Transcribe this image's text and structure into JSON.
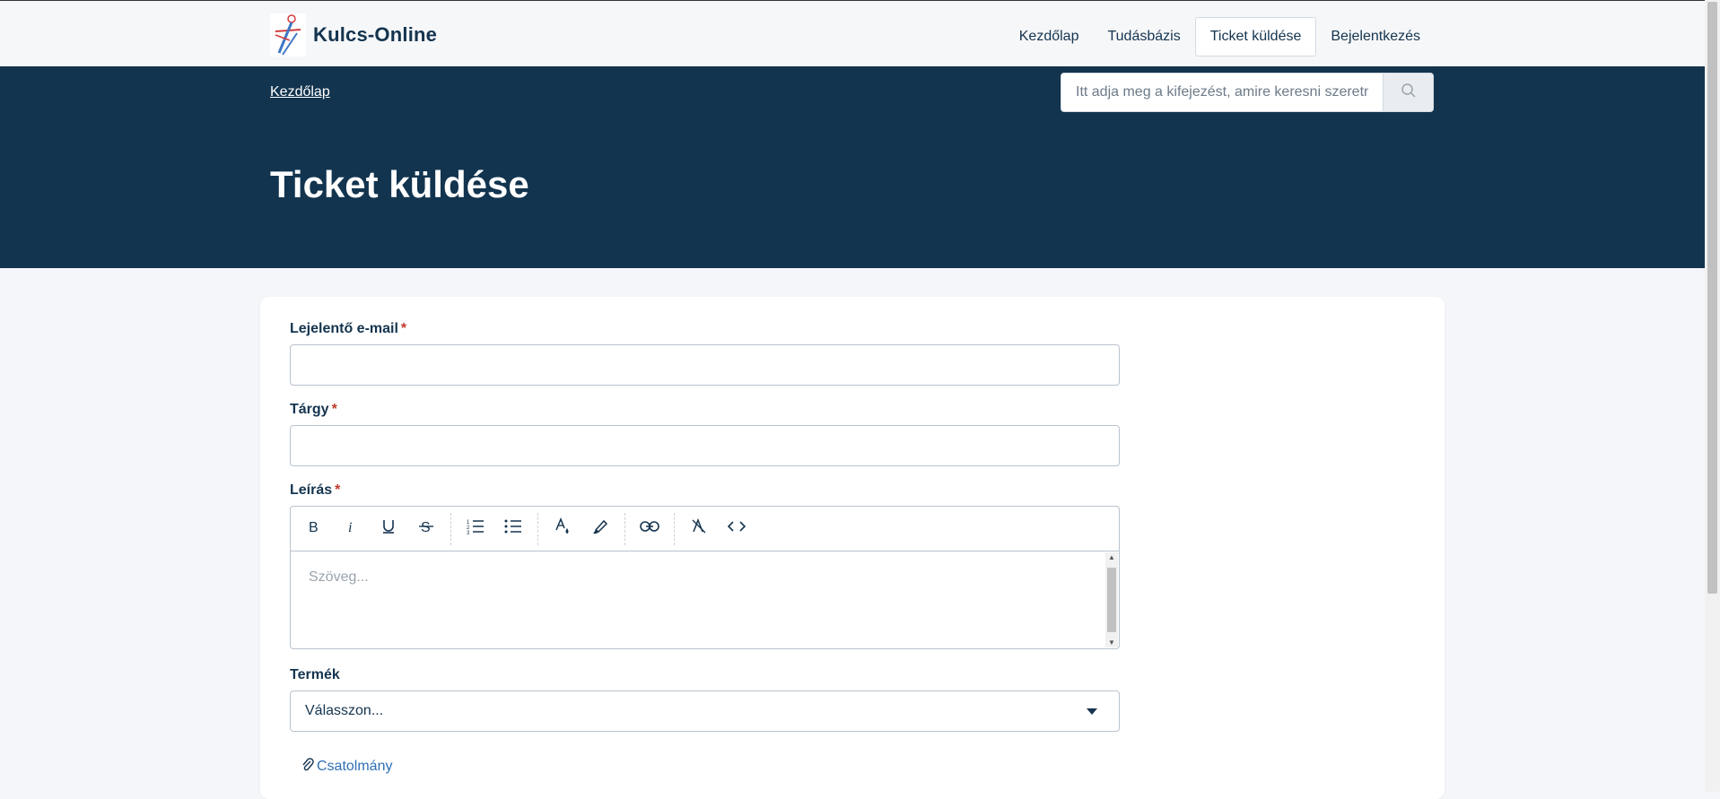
{
  "brand": {
    "name": "Kulcs-Online",
    "logo_icon": "kulcs-logo-icon"
  },
  "nav": {
    "items": [
      {
        "label": "Kezdőlap",
        "active": false
      },
      {
        "label": "Tudásbázis",
        "active": false
      },
      {
        "label": "Ticket küldése",
        "active": true
      },
      {
        "label": "Bejelentkezés",
        "active": false
      }
    ]
  },
  "breadcrumb": {
    "home": "Kezdőlap"
  },
  "search": {
    "placeholder": "Itt adja meg a kifejezést, amire keresni szeretne...",
    "value": ""
  },
  "page": {
    "title": "Ticket küldése"
  },
  "form": {
    "email": {
      "label": "Lejelentő e-mail",
      "required": "*",
      "value": ""
    },
    "subject": {
      "label": "Tárgy",
      "required": "*",
      "value": ""
    },
    "description": {
      "label": "Leírás",
      "required": "*",
      "placeholder": "Szöveg...",
      "toolbar": [
        "bold-icon",
        "italic-icon",
        "underline-icon",
        "strikethrough-icon",
        "ordered-list-icon",
        "bullet-list-icon",
        "text-color-icon",
        "highlight-icon",
        "link-icon",
        "clear-format-icon",
        "code-icon"
      ]
    },
    "product": {
      "label": "Termék",
      "selected": "Válasszon..."
    },
    "attachment": {
      "label": "Csatolmány"
    }
  },
  "colors": {
    "hero": "#12344f",
    "text": "#14344f",
    "required": "#c0392b",
    "link": "#2f6fb5"
  }
}
